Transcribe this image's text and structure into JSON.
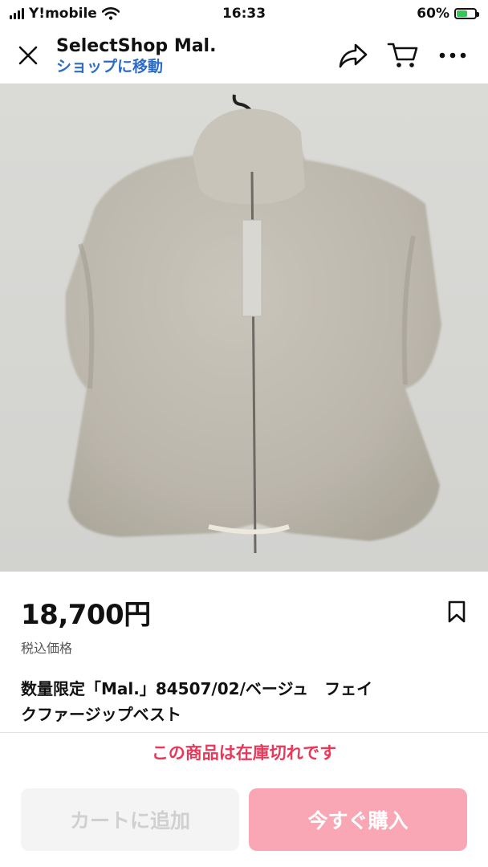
{
  "status_bar": {
    "carrier": "Y!mobile",
    "time": "16:33",
    "battery": "60%",
    "battery_level": 0.6
  },
  "header": {
    "shop_name": "SelectShop Mal.",
    "shop_link": "ショップに移動",
    "icons": [
      "close-icon",
      "share-icon",
      "cart-icon",
      "more-icon"
    ]
  },
  "product": {
    "price": "18,700円",
    "tax_note": "税込価格",
    "title_line1": "数量限定「Mal.」84507/02/ベージュ　フェイ",
    "title_line2": "クファージップベスト",
    "soldout_message": "この商品は在庫切れです"
  },
  "actions": {
    "add_to_cart": "カートに追加",
    "buy_now": "今すぐ購入"
  },
  "colors": {
    "link": "#2a6cc7",
    "soldout": "#e8395b",
    "buy_button": "#f9a7b5"
  }
}
